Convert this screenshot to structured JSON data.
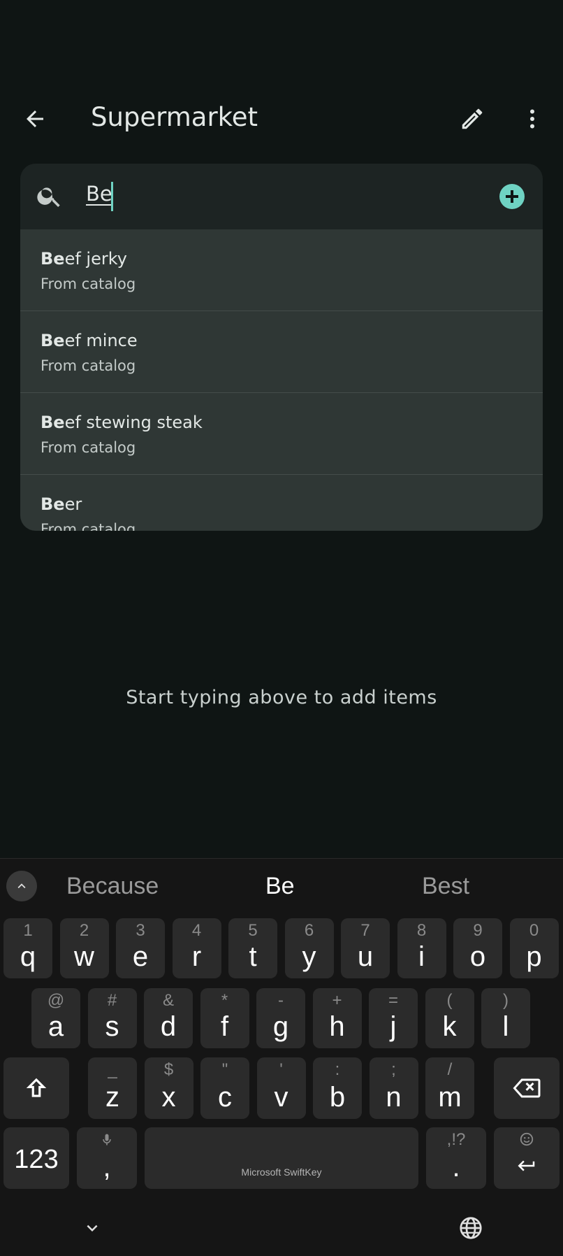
{
  "header": {
    "title": "Supermarket"
  },
  "search": {
    "typed": "Be",
    "placeholder": ""
  },
  "suggestions": [
    {
      "bold": "Be",
      "rest": "ef jerky",
      "source": "From catalog"
    },
    {
      "bold": "Be",
      "rest": "ef mince",
      "source": "From catalog"
    },
    {
      "bold": "Be",
      "rest": "ef stewing steak",
      "source": "From catalog"
    },
    {
      "bold": "Be",
      "rest": "er",
      "source": "From catalog"
    }
  ],
  "empty_message": "Start typing above to add items",
  "keyboard": {
    "predictions": [
      "Because",
      "Be",
      "Best"
    ],
    "row1": [
      {
        "k": "q",
        "h": "1"
      },
      {
        "k": "w",
        "h": "2"
      },
      {
        "k": "e",
        "h": "3"
      },
      {
        "k": "r",
        "h": "4"
      },
      {
        "k": "t",
        "h": "5"
      },
      {
        "k": "y",
        "h": "6"
      },
      {
        "k": "u",
        "h": "7"
      },
      {
        "k": "i",
        "h": "8"
      },
      {
        "k": "o",
        "h": "9"
      },
      {
        "k": "p",
        "h": "0"
      }
    ],
    "row2": [
      {
        "k": "a",
        "h": "@"
      },
      {
        "k": "s",
        "h": "#"
      },
      {
        "k": "d",
        "h": "&"
      },
      {
        "k": "f",
        "h": "*"
      },
      {
        "k": "g",
        "h": "-"
      },
      {
        "k": "h",
        "h": "+"
      },
      {
        "k": "j",
        "h": "="
      },
      {
        "k": "k",
        "h": "("
      },
      {
        "k": "l",
        "h": ")"
      }
    ],
    "row3": [
      {
        "k": "z",
        "h": "_"
      },
      {
        "k": "x",
        "h": "$"
      },
      {
        "k": "c",
        "h": "\""
      },
      {
        "k": "v",
        "h": "'"
      },
      {
        "k": "b",
        "h": ":"
      },
      {
        "k": "n",
        "h": ";"
      },
      {
        "k": "m",
        "h": "/"
      }
    ],
    "numbers_key": "123",
    "comma_key": ",",
    "period_key": ".",
    "period_hint": ",!?",
    "space_label": "Microsoft SwiftKey"
  },
  "colors": {
    "accent": "#6fd3c3",
    "background": "#0f1514",
    "dropdown": "#2f3735"
  },
  "icons": [
    "back-arrow-icon",
    "edit-pencil-icon",
    "more-vert-icon",
    "search-icon",
    "add-circle-icon",
    "chevron-up-icon",
    "shift-icon",
    "backspace-icon",
    "mic-icon",
    "emoji-icon",
    "enter-icon",
    "chevron-down-icon",
    "globe-icon"
  ]
}
